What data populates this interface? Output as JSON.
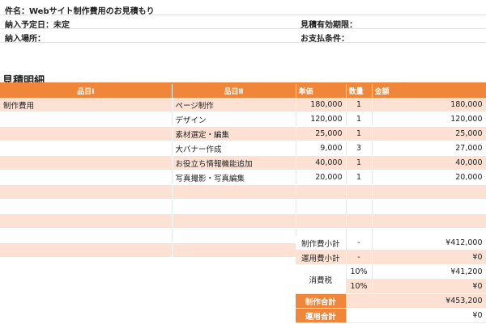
{
  "header": {
    "subject": "件名：Webサイト制作費用のお見積もり",
    "delivery_date": "納入予定日：未定",
    "valid_until": "見積有効期限：",
    "delivery_place": "納入場所：",
    "payment_terms": "お支払条件："
  },
  "section_title": "見積明細",
  "columns": [
    "品目Ⅰ",
    "品目Ⅱ",
    "単価",
    "数量",
    "金額"
  ],
  "rows": [
    {
      "item1": "制作費用",
      "item2": "ページ制作",
      "price": "180,000",
      "qty": "1",
      "amount": "180,000"
    },
    {
      "item1": "",
      "item2": "デザイン",
      "price": "120,000",
      "qty": "1",
      "amount": "120,000"
    },
    {
      "item1": "",
      "item2": "素材選定・編集",
      "price": "25,000",
      "qty": "1",
      "amount": "25,000"
    },
    {
      "item1": "",
      "item2": "大バナー作成",
      "price": "9,000",
      "qty": "3",
      "amount": "27,000"
    },
    {
      "item1": "",
      "item2": "お役立ち情報機能追加",
      "price": "40,000",
      "qty": "1",
      "amount": "40,000"
    },
    {
      "item1": "",
      "item2": "写真撮影・写真編集",
      "price": "20,000",
      "qty": "1",
      "amount": "20,000"
    },
    {
      "item1": "",
      "item2": "",
      "price": "",
      "qty": "",
      "amount": ""
    },
    {
      "item1": "",
      "item2": "",
      "price": "",
      "qty": "",
      "amount": ""
    },
    {
      "item1": "",
      "item2": "",
      "price": "",
      "qty": "",
      "amount": ""
    },
    {
      "item1": "",
      "item2": "",
      "price": "",
      "qty": "",
      "amount": ""
    },
    {
      "item1": "",
      "item2": "",
      "price": "",
      "qty": "",
      "amount": ""
    }
  ],
  "summary": {
    "production_subtotal_label": "制作費小計",
    "production_subtotal_dash": "-",
    "production_subtotal": "¥412,000",
    "operation_subtotal_label": "運用費小計",
    "operation_subtotal_dash": "-",
    "operation_subtotal": "¥0",
    "tax_label": "消費税",
    "tax_rate_1": "10%",
    "tax_amount_1": "¥41,200",
    "tax_rate_2": "10%",
    "tax_amount_2": "¥0",
    "production_total_label": "制作合計",
    "production_total": "¥453,200",
    "operation_total_label": "運用合計",
    "operation_total": "¥0"
  }
}
